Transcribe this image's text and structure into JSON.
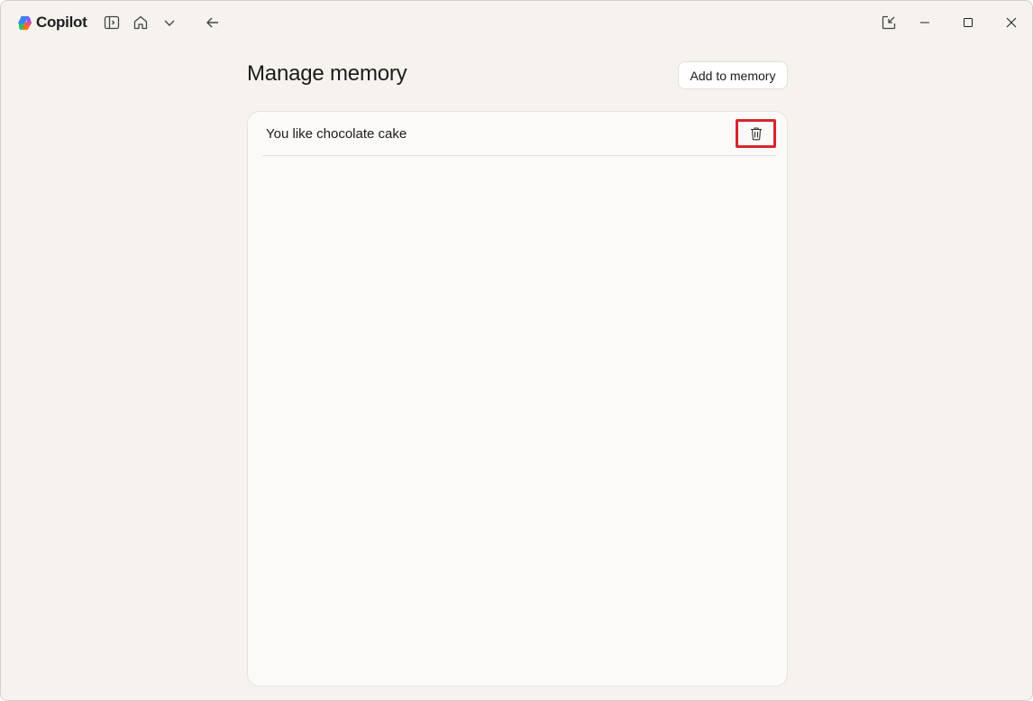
{
  "app": {
    "name": "Copilot",
    "logo_icon": "copilot-logo-icon"
  },
  "titlebar": {
    "icons": [
      "sidebar-toggle-icon",
      "home-icon",
      "chevron-down-icon",
      "back-arrow-icon",
      "pop-out-icon",
      "minimize-icon",
      "maximize-icon",
      "close-icon"
    ]
  },
  "page": {
    "title": "Manage memory",
    "add_button_label": "Add to memory"
  },
  "memories": [
    {
      "text": "You like chocolate cake",
      "action_icon": "trash-icon"
    }
  ],
  "colors": {
    "background": "#f6f3ef",
    "panel": "#fbfaf8",
    "highlight": "#d8262d"
  }
}
